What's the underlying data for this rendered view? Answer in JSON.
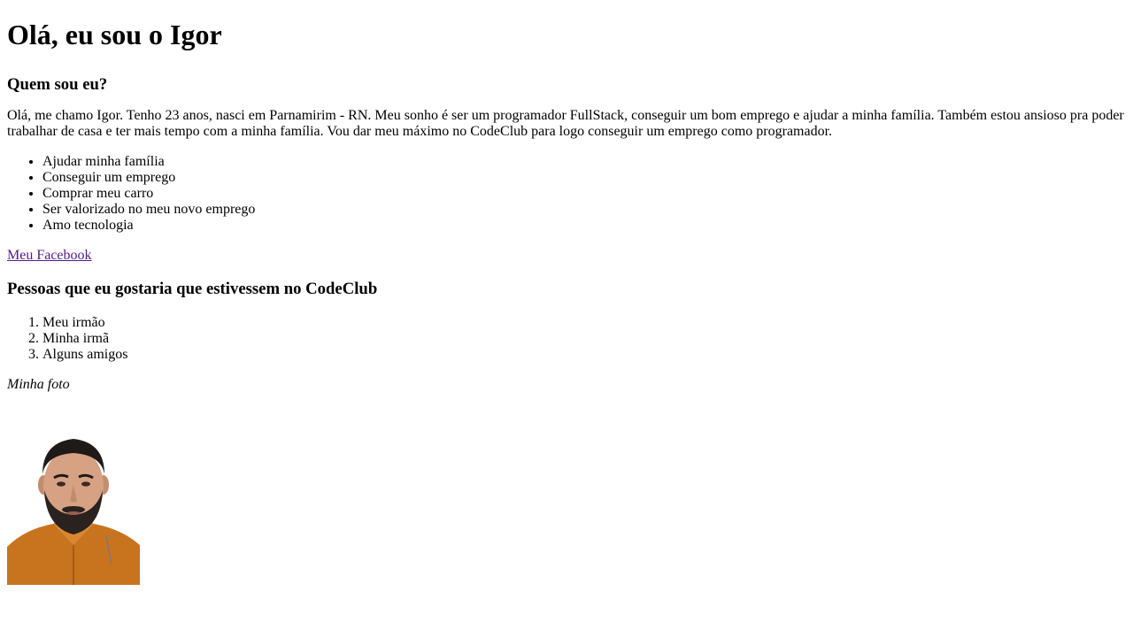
{
  "page": {
    "title": "Olá, eu sou o Igor",
    "about_heading": "Quem sou eu?",
    "about_text": "Olá, me chamo Igor. Tenho 23 anos, nasci em Parnamirim - RN. Meu sonho é ser um programador FullStack, conseguir um bom emprego e ajudar a minha família. Também estou ansioso pra poder trabalhar de casa e ter mais tempo com a minha família. Vou dar meu máximo no CodeClub para logo conseguir um emprego como programador.",
    "goals": [
      "Ajudar minha família",
      "Conseguir um emprego",
      "Comprar meu carro",
      "Ser valorizado no meu novo emprego",
      "Amo tecnologia"
    ],
    "facebook_link": "Meu Facebook",
    "people_heading": "Pessoas que eu gostaria que estivessem no CodeClub",
    "people": [
      "Meu irmão",
      "Minha irmã",
      "Alguns amigos"
    ],
    "photo_caption": "Minha foto"
  },
  "colors": {
    "link_visited": "#551a8b",
    "shirt": "#c8741e"
  }
}
